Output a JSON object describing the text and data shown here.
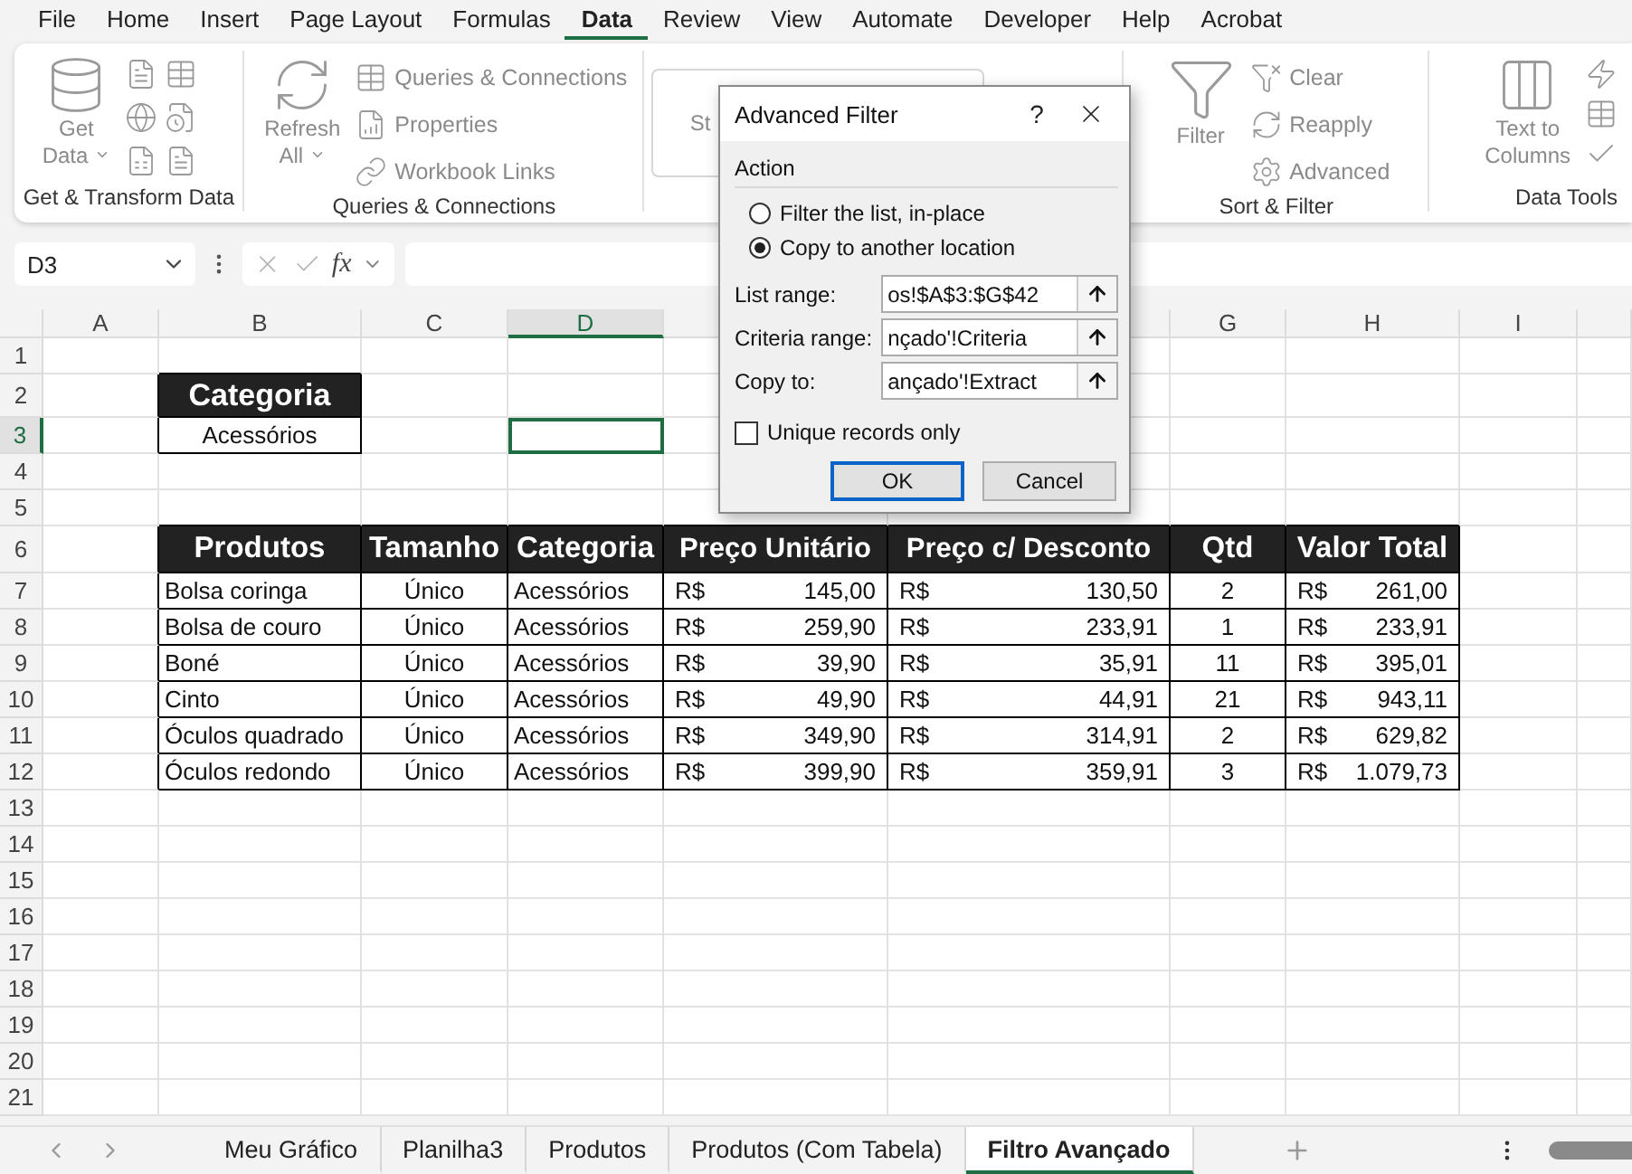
{
  "menu": [
    {
      "label": "File",
      "selected": false
    },
    {
      "label": "Home",
      "selected": false
    },
    {
      "label": "Insert",
      "selected": false
    },
    {
      "label": "Page Layout",
      "selected": false
    },
    {
      "label": "Formulas",
      "selected": false
    },
    {
      "label": "Data",
      "selected": true
    },
    {
      "label": "Review",
      "selected": false
    },
    {
      "label": "View",
      "selected": false
    },
    {
      "label": "Automate",
      "selected": false
    },
    {
      "label": "Developer",
      "selected": false
    },
    {
      "label": "Help",
      "selected": false
    },
    {
      "label": "Acrobat",
      "selected": false
    }
  ],
  "ribbon": {
    "get_transform": {
      "label": "Get & Transform Data",
      "get_data": {
        "lines": [
          "Get",
          "Data"
        ],
        "disabled": true
      }
    },
    "queries": {
      "label": "Queries & Connections",
      "refresh": {
        "lines": [
          "Refresh",
          "All"
        ],
        "disabled": true
      },
      "items": [
        {
          "label": "Queries & Connections",
          "disabled": true
        },
        {
          "label": "Properties",
          "disabled": true
        },
        {
          "label": "Workbook Links",
          "disabled": true
        }
      ]
    },
    "gallery_text": "St",
    "sort_filter": {
      "label": "Sort & Filter",
      "filter": {
        "label": "Filter",
        "disabled": true
      },
      "items": [
        {
          "label": "Clear",
          "disabled": true
        },
        {
          "label": "Reapply",
          "disabled": true
        },
        {
          "label": "Advanced",
          "disabled": true
        }
      ]
    },
    "data_tools": {
      "label": "Data Tools",
      "text_to_columns": {
        "lines": [
          "Text to",
          "Columns"
        ],
        "disabled": true
      }
    }
  },
  "formula_bar": {
    "name_box": "D3",
    "function_label": "fx"
  },
  "columns": [
    {
      "label": "A",
      "selected": false
    },
    {
      "label": "B",
      "selected": false
    },
    {
      "label": "C",
      "selected": false
    },
    {
      "label": "D",
      "selected": true
    },
    {
      "selected": false
    },
    {
      "selected": false
    },
    {
      "label": "G",
      "selected": false
    },
    {
      "label": "H",
      "selected": false
    },
    {
      "label": "I",
      "selected": false
    },
    {
      "selected": false
    }
  ],
  "rows": [
    {
      "label": "1",
      "selected": false
    },
    {
      "label": "2",
      "selected": false
    },
    {
      "label": "3",
      "selected": true
    },
    {
      "label": "4",
      "selected": false
    },
    {
      "label": "5",
      "selected": false
    },
    {
      "label": "6",
      "selected": false
    },
    {
      "label": "7",
      "selected": false
    },
    {
      "label": "8",
      "selected": false
    },
    {
      "label": "9",
      "selected": false
    },
    {
      "label": "10",
      "selected": false
    },
    {
      "label": "11",
      "selected": false
    },
    {
      "label": "12",
      "selected": false
    },
    {
      "label": "13",
      "selected": false
    },
    {
      "label": "14",
      "selected": false
    },
    {
      "label": "15",
      "selected": false
    },
    {
      "label": "16",
      "selected": false
    },
    {
      "label": "17",
      "selected": false
    },
    {
      "label": "18",
      "selected": false
    },
    {
      "label": "19",
      "selected": false
    },
    {
      "label": "20",
      "selected": false
    },
    {
      "label": "21",
      "selected": false
    }
  ],
  "criteria": {
    "header": "Categoria",
    "value": "Acessórios"
  },
  "table": {
    "columns": [
      {
        "label": "Produtos",
        "kind": "text"
      },
      {
        "label": "Tamanho",
        "kind": "center"
      },
      {
        "label": "Categoria",
        "kind": "text"
      },
      {
        "label": "Preço Unitário",
        "kind": "money"
      },
      {
        "label": "Preço c/ Desconto",
        "kind": "money"
      },
      {
        "label": "Qtd",
        "kind": "center"
      },
      {
        "label": "Valor Total",
        "kind": "money"
      }
    ],
    "rows": [
      [
        "Bolsa coringa",
        "Único",
        "Acessórios",
        {
          "currency": "R$",
          "amount": "145,00"
        },
        {
          "currency": "R$",
          "amount": "130,50"
        },
        "2",
        {
          "currency": "R$",
          "amount": "261,00"
        }
      ],
      [
        "Bolsa de couro",
        "Único",
        "Acessórios",
        {
          "currency": "R$",
          "amount": "259,90"
        },
        {
          "currency": "R$",
          "amount": "233,91"
        },
        "1",
        {
          "currency": "R$",
          "amount": "233,91"
        }
      ],
      [
        "Boné",
        "Único",
        "Acessórios",
        {
          "currency": "R$",
          "amount": "39,90"
        },
        {
          "currency": "R$",
          "amount": "35,91"
        },
        "11",
        {
          "currency": "R$",
          "amount": "395,01"
        }
      ],
      [
        "Cinto",
        "Único",
        "Acessórios",
        {
          "currency": "R$",
          "amount": "49,90"
        },
        {
          "currency": "R$",
          "amount": "44,91"
        },
        "21",
        {
          "currency": "R$",
          "amount": "943,11"
        }
      ],
      [
        "Óculos quadrado",
        "Único",
        "Acessórios",
        {
          "currency": "R$",
          "amount": "349,90"
        },
        {
          "currency": "R$",
          "amount": "314,91"
        },
        "2",
        {
          "currency": "R$",
          "amount": "629,82"
        }
      ],
      [
        "Óculos redondo",
        "Único",
        "Acessórios",
        {
          "currency": "R$",
          "amount": "399,90"
        },
        {
          "currency": "R$",
          "amount": "359,91"
        },
        "3",
        {
          "currency": "R$",
          "amount": "1.079,73"
        }
      ]
    ]
  },
  "dialog": {
    "title": "Advanced Filter",
    "help": "?",
    "group_label": "Action",
    "options": [
      {
        "label": "Filter the list, in-place",
        "selected": false
      },
      {
        "label": "Copy to another location",
        "selected": true
      }
    ],
    "fields": [
      {
        "label": "List range:",
        "value": "os!$A$3:$G$42"
      },
      {
        "label": "Criteria range:",
        "value": "nçado'!Criteria"
      },
      {
        "label": "Copy to:",
        "value": "ançado'!Extract"
      }
    ],
    "unique": {
      "label": "Unique records only",
      "checked": false
    },
    "buttons": [
      {
        "label": "OK",
        "kind": "primary"
      },
      {
        "label": "Cancel",
        "kind": "normal"
      }
    ]
  },
  "sheet_tabs": [
    {
      "label": "Meu Gráfico",
      "selected": false
    },
    {
      "label": "Planilha3",
      "selected": false
    },
    {
      "label": "Produtos",
      "selected": false
    },
    {
      "label": "Produtos (Com Tabela)",
      "selected": false
    },
    {
      "label": "Filtro Avançado",
      "selected": true
    }
  ]
}
